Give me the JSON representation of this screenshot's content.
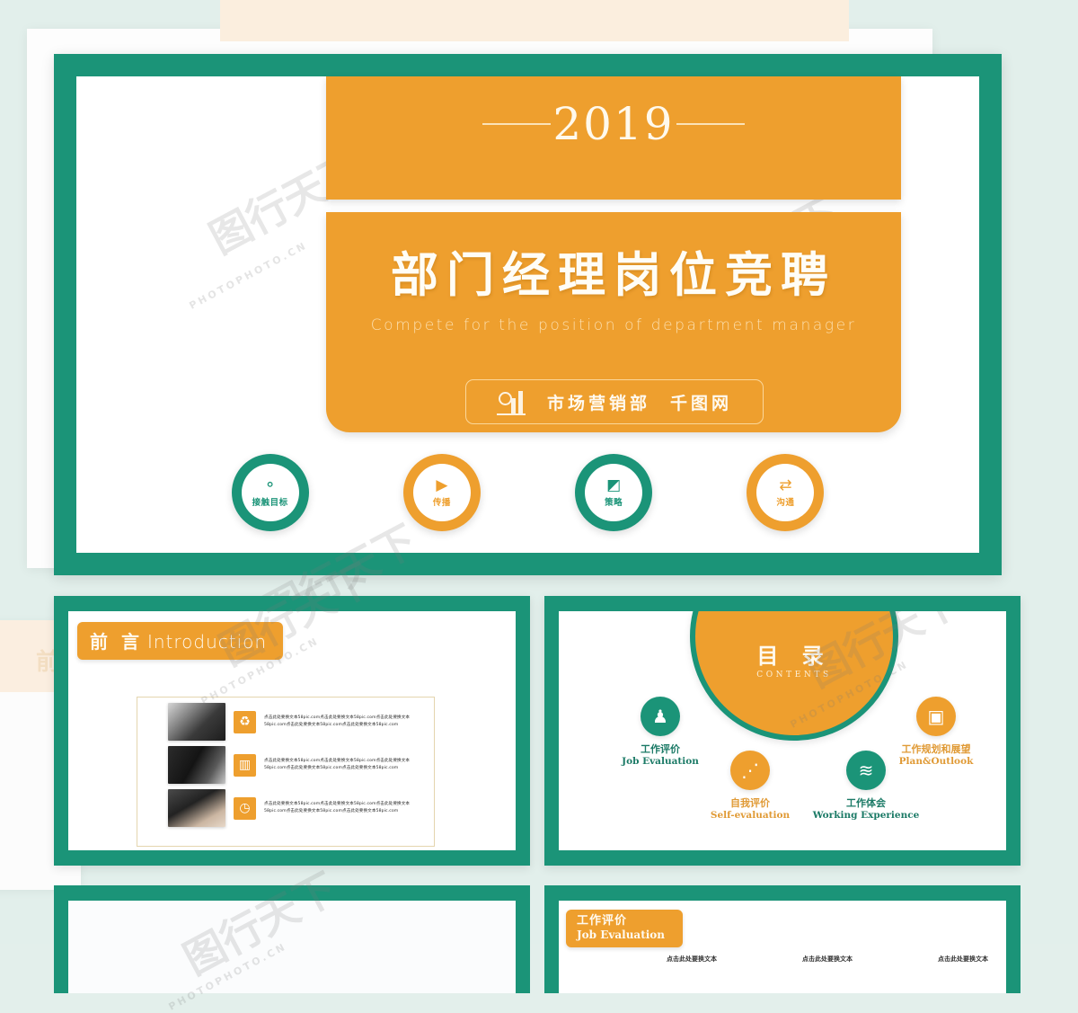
{
  "palette": {
    "teal": "#1b9478",
    "orange": "#ee9f2e",
    "cream": "#fbeede",
    "mint_bg": "#e2efeb",
    "card_border": "#e4d5ae"
  },
  "slide_title": {
    "year": "2019",
    "main_title": "部门经理岗位竞聘",
    "sub_title": "Compete  for  the  position  of  department  manager",
    "department_badge": {
      "icon": "bar-chart-magnifier-icon",
      "department": "市场营销部",
      "source": "千图网"
    },
    "circles": [
      {
        "label": "接触目标",
        "icon": "network-nodes-icon",
        "glyph": "⚬",
        "color": "teal"
      },
      {
        "label": "传播",
        "icon": "film-play-icon",
        "glyph": "▶",
        "color": "orange"
      },
      {
        "label": "策略",
        "icon": "presentation-board-icon",
        "glyph": "◩",
        "color": "teal"
      },
      {
        "label": "沟通",
        "icon": "people-exchange-icon",
        "glyph": "⇄",
        "color": "orange"
      }
    ]
  },
  "slide_introduction": {
    "tag_cn": "前 言",
    "tag_en": "Introduction",
    "rows": [
      {
        "thumb": "laptop-keyboard-photo",
        "icon": "recycle-icon",
        "glyph": "♻",
        "text": "点击此处要换文本58pic.com点击此处要换文本58pic.com点击此处要换文本58pic.com点击此处要换文本58pic.com点击此处要换文本58pic.com"
      },
      {
        "thumb": "desk-laptop-photo",
        "icon": "bar-chart-icon",
        "glyph": "▥",
        "text": "点击此处要换文本58pic.com点击此处要换文本58pic.com点击此处要换文本58pic.com点击此处要换文本58pic.com点击此处要换文本58pic.com"
      },
      {
        "thumb": "hand-phone-photo",
        "icon": "search-clock-icon",
        "glyph": "◷",
        "text": "点击此处要换文本58pic.com点击此处要换文本58pic.com点击此处要换文本58pic.com点击此处要换文本58pic.com点击此处要换文本58pic.com"
      }
    ]
  },
  "slide_contents": {
    "dome_cn": "目 录",
    "dome_en": "CONTENTS",
    "items": [
      {
        "cn": "工作评价",
        "en": "Job Evaluation",
        "icon": "person-standing-icon",
        "glyph": "♟",
        "color": "teal"
      },
      {
        "cn": "自我评价",
        "en": "Self-evaluation",
        "icon": "node-graph-icon",
        "glyph": "⋰",
        "color": "orange"
      },
      {
        "cn": "工作体会",
        "en": "Working Experience",
        "icon": "layers-stack-icon",
        "glyph": "≋",
        "color": "teal"
      },
      {
        "cn": "工作规划和展望",
        "en": "Plan&Outlook",
        "icon": "chip-icon",
        "glyph": "▣",
        "color": "orange"
      }
    ]
  },
  "slide_job_evaluation": {
    "tag_cn": "工作评价",
    "tag_en": "Job Evaluation",
    "columns": [
      "点击此处要换文本",
      "点击此处要换文本",
      "点击此处要换文本"
    ]
  },
  "side_preview": {
    "label": "前"
  },
  "watermarks": {
    "mark_cn": "图行天下",
    "mark_en": "PHOTOPHOTO.CN"
  }
}
